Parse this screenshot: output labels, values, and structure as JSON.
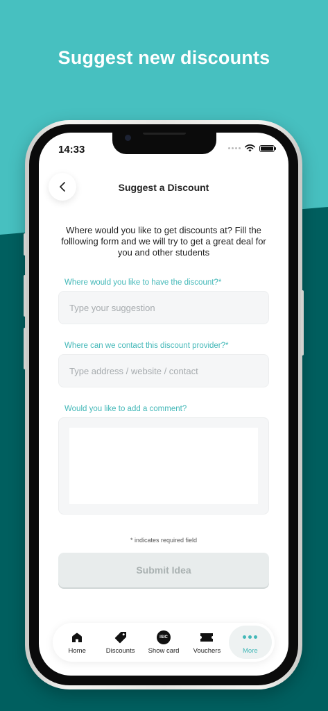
{
  "headline": "Suggest new discounts",
  "status": {
    "time": "14:33"
  },
  "screen": {
    "title": "Suggest a Discount",
    "intro": "Where would you like to get discounts at? Fill the folllowing form and we will try to get a great deal for you and other students"
  },
  "form": {
    "location": {
      "label": "Where would you like to have the discount?*",
      "placeholder": "Type your suggestion",
      "value": ""
    },
    "contact": {
      "label": "Where can we contact this discount provider?*",
      "placeholder": "Type address / website / contact",
      "value": ""
    },
    "comment": {
      "label": "Would you like to add a comment?",
      "value": ""
    },
    "required_note": "* indicates required field",
    "submit_label": "Submit Idea"
  },
  "nav": {
    "items": [
      {
        "label": "Home",
        "icon": "home-icon"
      },
      {
        "label": "Discounts",
        "icon": "tag-icon"
      },
      {
        "label": "Show card",
        "icon": "isic-card-icon",
        "badge": "ISIC"
      },
      {
        "label": "Vouchers",
        "icon": "ticket-icon"
      },
      {
        "label": "More",
        "icon": "more-dots-icon",
        "active": true
      }
    ]
  },
  "colors": {
    "accent": "#43b8b8",
    "bg_light": "#47c0c0",
    "bg_dark": "#005f5f",
    "submit_disabled": "#e8ecec"
  }
}
